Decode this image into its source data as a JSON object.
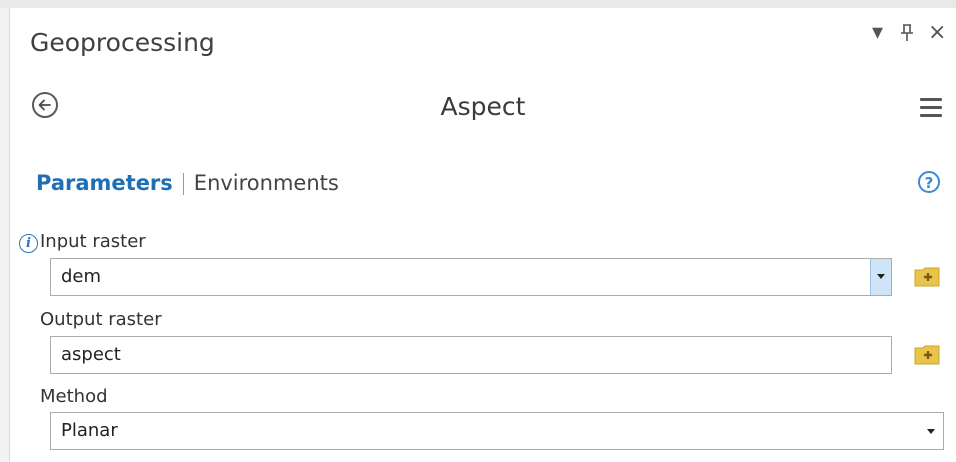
{
  "pane": {
    "title": "Geoprocessing",
    "controls": {
      "dropdown": "▾",
      "pin": "⊥",
      "close": "×"
    }
  },
  "tool": {
    "name": "Aspect"
  },
  "tabs": {
    "active": "Parameters",
    "inactive": "Environments"
  },
  "help": {
    "glyph": "?"
  },
  "params": {
    "input_raster": {
      "label": "Input raster",
      "value": "dem"
    },
    "output_raster": {
      "label": "Output raster",
      "value": "aspect"
    },
    "method": {
      "label": "Method",
      "value": "Planar"
    }
  },
  "info_glyph": "i",
  "colors": {
    "accent": "#1f6fb5",
    "folder": "#e8c44a"
  }
}
